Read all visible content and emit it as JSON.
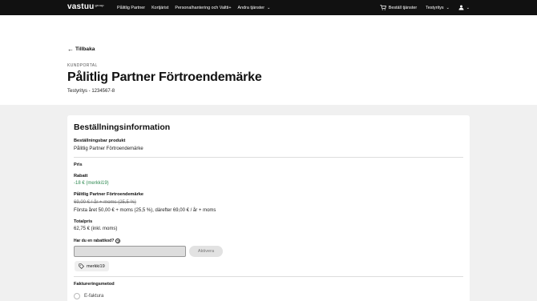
{
  "nav": {
    "logo": "vastuu",
    "logo_suffix": "group",
    "links": [
      {
        "label": "Pålitlig Partner"
      },
      {
        "label": "Kortjärist"
      },
      {
        "label": "Personalhantering och Valtti+"
      },
      {
        "label": "Andra tjänster"
      }
    ],
    "order_services": "Beställ tjänster",
    "company_menu": "Testyritys"
  },
  "header": {
    "back_label": "Tillbaka",
    "eyebrow": "KUNDPORTAL",
    "title": "Pålitlig Partner Förtroendemärke",
    "company": "Testyritys - 1234567-8"
  },
  "order": {
    "title": "Beställningsinformation",
    "product_label": "Beställningsbar produkt",
    "product_value": "Pålitlig Partner Förtroendemärke",
    "price_heading": "Pris",
    "discount_label": "Rabatt",
    "discount_value": "-18 € (merkki19)",
    "item_label": "Pålitlig Partner Förtroendemärke",
    "old_price": "69,00 € / år + moms (25,5 %)",
    "new_price": "Första året 50,00 € + moms (25,5 %), därefter 69,00 € / år + moms",
    "total_label": "Totalpris",
    "total_value": "62,75 € (inkl. moms)",
    "coupon_question": "Har du en rabattkod?",
    "coupon_input_value": "",
    "activate_label": "Aktivera",
    "applied_code": "merkki19",
    "billing_label": "Faktureringsmetod",
    "billing_option": "E-faktura"
  },
  "colors": {
    "nav_bg": "#111111",
    "content_bg": "#f0f0f0",
    "discount_green": "#2f8a52"
  }
}
